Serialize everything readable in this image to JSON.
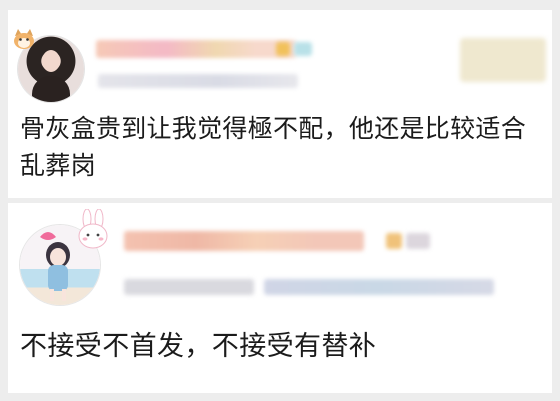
{
  "comments": [
    {
      "avatar_icon": "user-avatar-photo",
      "badge_icon": "pet-badge-icon",
      "text_line1": "骨灰盒贵到让我觉得極不配，他还是比较适合",
      "text_line2": "乱葬岗",
      "name_blur_colors": [
        "#f6c9b6",
        "#f4b9c6",
        "#f0d8b0",
        "#b8e1e8",
        "#f1c15b"
      ],
      "action_blur_color": "#efe8cf"
    },
    {
      "avatar_icon": "user-avatar-illustration",
      "badge_icon": "bunny-icon",
      "text_line1": "不接受不首发，不接受有替补",
      "name_blur_colors": [
        "#f4c2b0",
        "#efb8a6",
        "#f6d0b6",
        "#f0c27a",
        "#dcd6dd"
      ],
      "meta_blur_colors": [
        "#d9d9df",
        "#c9d8e6",
        "#d0d5e6"
      ]
    }
  ]
}
